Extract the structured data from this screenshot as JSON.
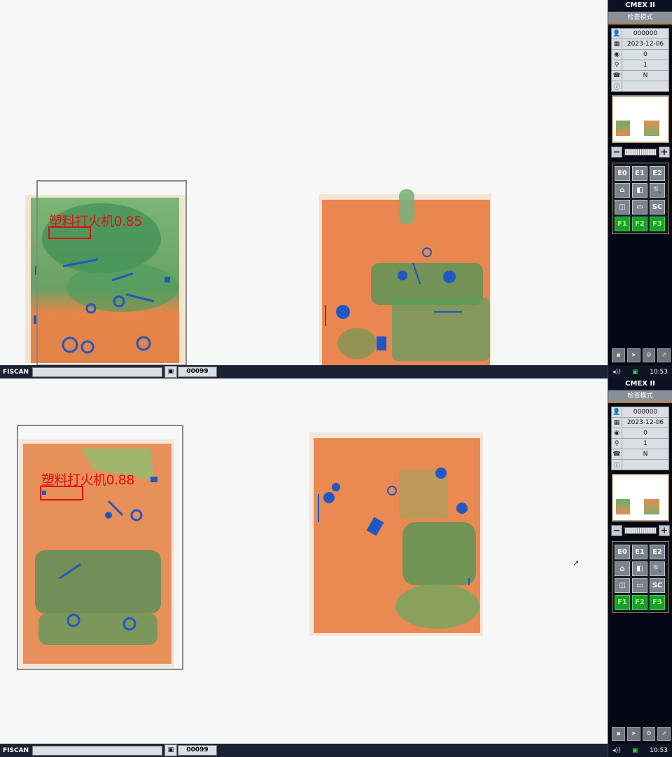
{
  "app": {
    "brand": "CMEX II",
    "mode": "检查模式",
    "status_logo": "FISCAN"
  },
  "info_icons": [
    "user-icon",
    "calendar-icon",
    "counter-icon",
    "magnifier-icon",
    "operator-icon",
    "info-icon"
  ],
  "screens": [
    {
      "info": [
        "000000",
        "2023-12-06",
        "0",
        "1",
        "N",
        ""
      ],
      "detection": {
        "label": "塑料打火机0.85"
      },
      "bag_count": "00099",
      "clock": "10:53"
    },
    {
      "info": [
        "000000",
        "2023-12-06",
        "0",
        "1",
        "N",
        ""
      ],
      "detection": {
        "label": "塑料打火机0.88"
      },
      "bag_count": "00099",
      "clock": "10:53"
    }
  ],
  "keys": [
    {
      "label": "E0",
      "type": "normal"
    },
    {
      "label": "E1",
      "type": "normal"
    },
    {
      "label": "E2",
      "type": "normal"
    },
    {
      "label": "⌂",
      "type": "normal"
    },
    {
      "label": "◧",
      "type": "normal"
    },
    {
      "label": "🔍",
      "type": "normal"
    },
    {
      "label": "◫",
      "type": "normal"
    },
    {
      "label": "▭",
      "type": "normal"
    },
    {
      "label": "SC",
      "type": "normal"
    },
    {
      "label": "F1",
      "type": "green"
    },
    {
      "label": "F2",
      "type": "green"
    },
    {
      "label": "F3",
      "type": "green"
    }
  ],
  "zoom": {
    "minus": "−",
    "plus": "+"
  },
  "tray_icons": [
    "speaker-icon",
    "network-icon"
  ],
  "colors": {
    "sidebar_bg": "#050814",
    "detection_red": "#dd1111",
    "statusbar_bg": "#1b2233",
    "accent_gold": "#b8862e"
  }
}
